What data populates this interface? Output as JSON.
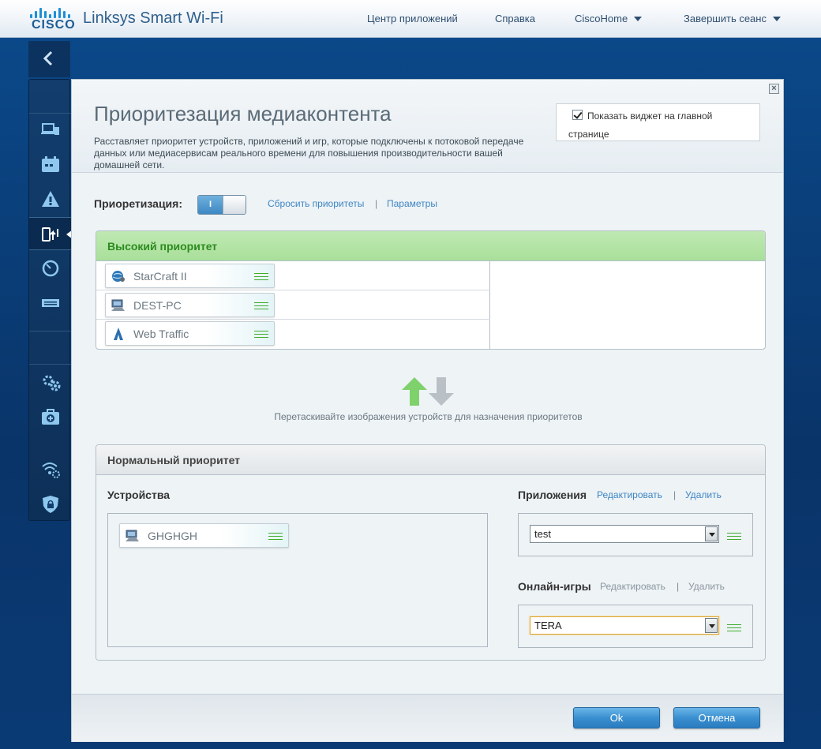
{
  "header": {
    "brand": "CISCO",
    "app_title": "Linksys Smart Wi-Fi",
    "nav": {
      "apps": "Центр приложений",
      "help": "Справка",
      "router": "CiscoHome",
      "logout": "Завершить сеанс"
    }
  },
  "sidebar": {
    "items": [
      {
        "icon": "devices-icon"
      },
      {
        "icon": "calendar-icon"
      },
      {
        "icon": "warning-icon"
      },
      {
        "icon": "media-priority-icon",
        "active": true
      },
      {
        "icon": "speedometer-icon"
      },
      {
        "icon": "usb-icon"
      },
      {
        "icon": "settings-icon"
      },
      {
        "icon": "first-aid-icon"
      },
      {
        "icon": "wifi-settings-icon"
      },
      {
        "icon": "security-icon"
      }
    ]
  },
  "modal": {
    "title": "Приоритезация медиаконтента",
    "description": "Расставляет приоритет устройств, приложений и игр, которые подключены к потоковой передаче данных или медиасервисам реального времени для повышения производительности вашей домашней сети.",
    "widget_label": "Показать виджет на главной странице",
    "widget_checked": true,
    "prioritization_label": "Приоретизация:",
    "toggle_on_label": "I",
    "reset_link": "Сбросить приоритеты",
    "separator": "|",
    "params_link": "Параметры",
    "high": {
      "title": "Высокий приоритет",
      "items": [
        {
          "label": "StarCraft II",
          "icon": "game-globe-icon"
        },
        {
          "label": "DEST-PC",
          "icon": "computer-icon"
        },
        {
          "label": "Web Traffic",
          "icon": "web-traffic-icon"
        }
      ]
    },
    "drag_hint": "Перетаскивайте изображения устройств для назначения приоритетов",
    "normal": {
      "title": "Нормальный приоритет",
      "devices_label": "Устройства",
      "devices": [
        {
          "label": "GHGHGH",
          "icon": "computer-icon"
        }
      ],
      "apps_label": "Приложения",
      "apps_edit": "Редактировать",
      "apps_delete": "Удалить",
      "apps_selected": "test",
      "games_label": "Онлайн-игры",
      "games_edit": "Редактировать",
      "games_delete": "Удалить",
      "games_selected": "TERA"
    },
    "ok_label": "Ok",
    "cancel_label": "Отмена"
  },
  "colors": {
    "accent": "#3e86c4",
    "high_priority": "#2d8b1f",
    "grip": "#3fae2e"
  }
}
